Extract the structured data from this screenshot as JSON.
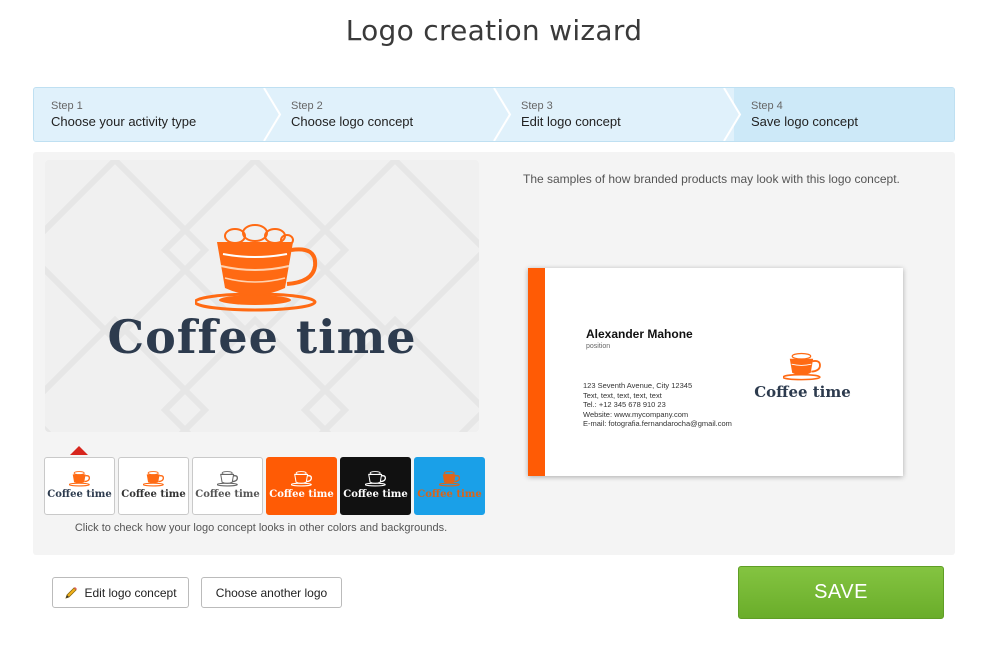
{
  "page": {
    "title": "Logo creation wizard"
  },
  "steps": [
    {
      "num": "Step 1",
      "label": "Choose your activity type",
      "active": false
    },
    {
      "num": "Step 2",
      "label": "Choose logo concept",
      "active": false
    },
    {
      "num": "Step 3",
      "label": "Edit logo concept",
      "active": false
    },
    {
      "num": "Step 4",
      "label": "Save logo concept",
      "active": true
    }
  ],
  "logo": {
    "text": "Coffee time",
    "accent_color": "#ff6a13",
    "text_color": "#2d3b4e"
  },
  "swatches": [
    {
      "text": "Coffee time",
      "bg": "#ffffff",
      "text_color": "#2d3b4e",
      "cup_color": "#ff6a13",
      "selected": true
    },
    {
      "text": "Coffee time",
      "bg": "#ffffff",
      "text_color": "#333333",
      "cup_color": "#ff6a13",
      "selected": false
    },
    {
      "text": "Coffee time",
      "bg": "#ffffff",
      "text_color": "#555555",
      "cup_color": "#666666",
      "selected": false
    },
    {
      "text": "Coffee time",
      "bg": "#ff5b05",
      "text_color": "#ffffff",
      "cup_color": "#ffffff",
      "selected": false
    },
    {
      "text": "Coffee time",
      "bg": "#111111",
      "text_color": "#ffffff",
      "cup_color": "#ffffff",
      "selected": false
    },
    {
      "text": "Coffee time",
      "bg": "#1aa0e8",
      "text_color": "#d9641a",
      "cup_color": "#e06418",
      "selected": false
    }
  ],
  "swatch_hint": "Click to check how your logo concept looks in other colors and backgrounds.",
  "samples_text": "The samples of how branded products may look with this logo concept.",
  "card": {
    "name": "Alexander Mahone",
    "position": "position",
    "lines": [
      "123 Seventh Avenue, City 12345",
      "Text, text, text, text, text",
      "Tel.: +12 345 678 910 23",
      "Website: www.mycompany.com",
      "E-mail: fotografia.fernandarocha@gmail.com"
    ],
    "stripe_color": "#ff5b05"
  },
  "buttons": {
    "edit": "Edit logo concept",
    "choose": "Choose another logo",
    "save": "SAVE"
  },
  "icons": {
    "edit": "pencil-icon",
    "logo": "coffee-cup-icon"
  }
}
